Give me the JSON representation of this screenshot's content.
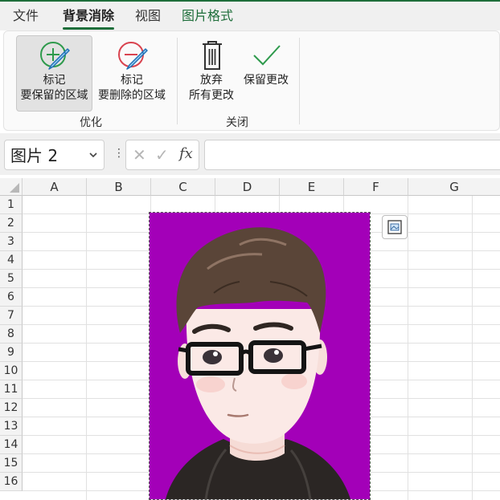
{
  "menu": {
    "tabs": [
      {
        "label": "文件"
      },
      {
        "label": "背景消除",
        "active": true
      },
      {
        "label": "视图"
      },
      {
        "label": "图片格式"
      }
    ],
    "accent_color": "#1e6e3a"
  },
  "ribbon": {
    "groups": [
      {
        "label": "优化",
        "buttons": [
          {
            "icon": "pencil-plus-icon",
            "line1": "标记",
            "line2": "要保留的区域",
            "selected": true
          },
          {
            "icon": "pencil-minus-icon",
            "line1": "标记",
            "line2": "要删除的区域"
          }
        ]
      },
      {
        "label": "关闭",
        "buttons": [
          {
            "icon": "trash-icon",
            "line1": "放弃",
            "line2": "所有更改"
          },
          {
            "icon": "checkmark-icon",
            "line1": "保留更改"
          }
        ]
      }
    ]
  },
  "formula_bar": {
    "name_box": "图片 2",
    "cancel_symbol": "✕",
    "enter_symbol": "✓",
    "fx": "fx",
    "formula": ""
  },
  "sheet": {
    "columns": [
      "A",
      "B",
      "C",
      "D",
      "E",
      "F",
      "G"
    ],
    "rows": [
      "1",
      "2",
      "3",
      "4",
      "5",
      "6",
      "7",
      "8",
      "9",
      "10",
      "11",
      "12",
      "13",
      "14",
      "15",
      "16"
    ],
    "picture": {
      "name": "图片 2",
      "background_color": "#a300b8",
      "content": "cartoon-avatar-man-with-glasses"
    }
  }
}
